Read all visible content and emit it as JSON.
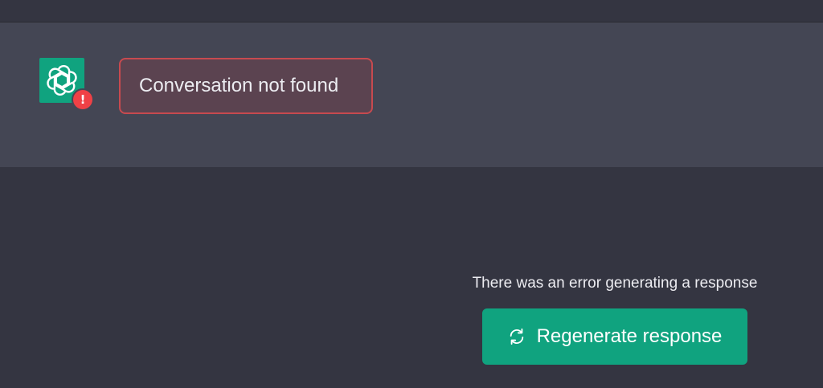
{
  "message": {
    "avatar_icon": "openai-logo-icon",
    "badge_icon": "exclamation-icon",
    "badge_text": "!",
    "error_text": "Conversation not found"
  },
  "footer": {
    "error_text": "There was an error generating a response",
    "regenerate_label": "Regenerate response",
    "regenerate_icon": "refresh-icon"
  },
  "colors": {
    "background": "#343541",
    "message_row": "#444654",
    "accent": "#10a37f",
    "error": "#ef4146"
  }
}
